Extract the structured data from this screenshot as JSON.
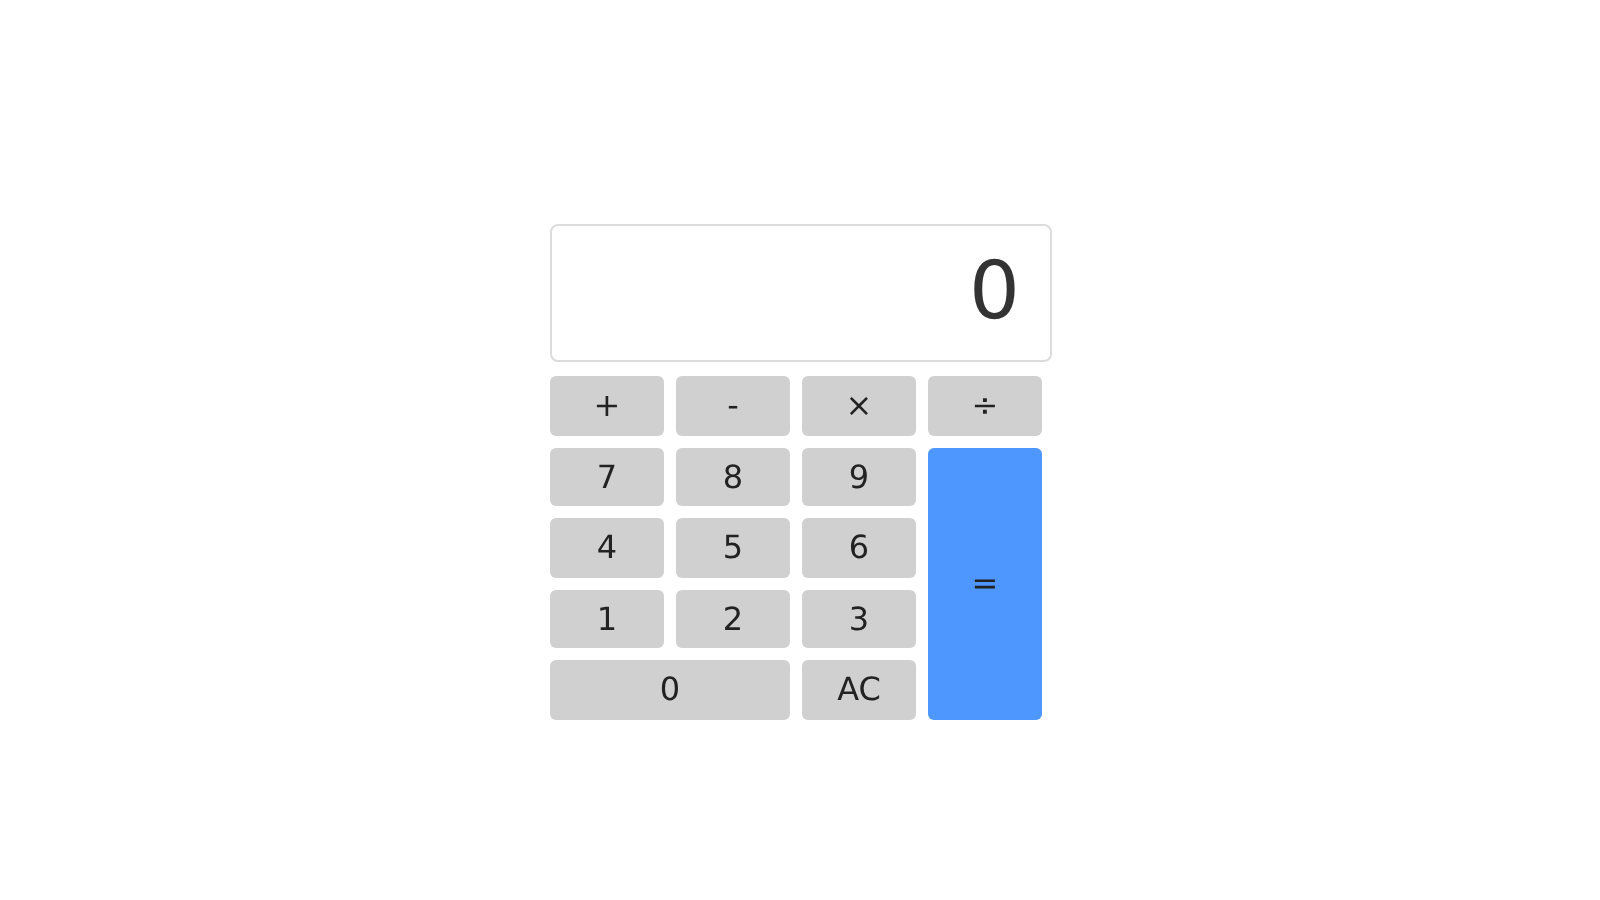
{
  "display": {
    "value": "0"
  },
  "keys": [
    {
      "label": "+",
      "kind": "operator",
      "wide": false
    },
    {
      "label": "-",
      "kind": "operator",
      "wide": false
    },
    {
      "label": "×",
      "kind": "operator",
      "wide": false
    },
    {
      "label": "÷",
      "kind": "operator",
      "wide": false
    },
    {
      "label": "7",
      "kind": "digit",
      "wide": false
    },
    {
      "label": "8",
      "kind": "digit",
      "wide": false
    },
    {
      "label": "9",
      "kind": "digit",
      "wide": false
    },
    {
      "label": "=",
      "kind": "equals",
      "wide": false
    },
    {
      "label": "4",
      "kind": "digit",
      "wide": false
    },
    {
      "label": "5",
      "kind": "digit",
      "wide": false
    },
    {
      "label": "6",
      "kind": "digit",
      "wide": false
    },
    {
      "label": "1",
      "kind": "digit",
      "wide": false
    },
    {
      "label": "2",
      "kind": "digit",
      "wide": false
    },
    {
      "label": "3",
      "kind": "digit",
      "wide": false
    },
    {
      "label": "0",
      "kind": "digit",
      "wide": true
    },
    {
      "label": "AC",
      "kind": "clear",
      "wide": false
    }
  ]
}
